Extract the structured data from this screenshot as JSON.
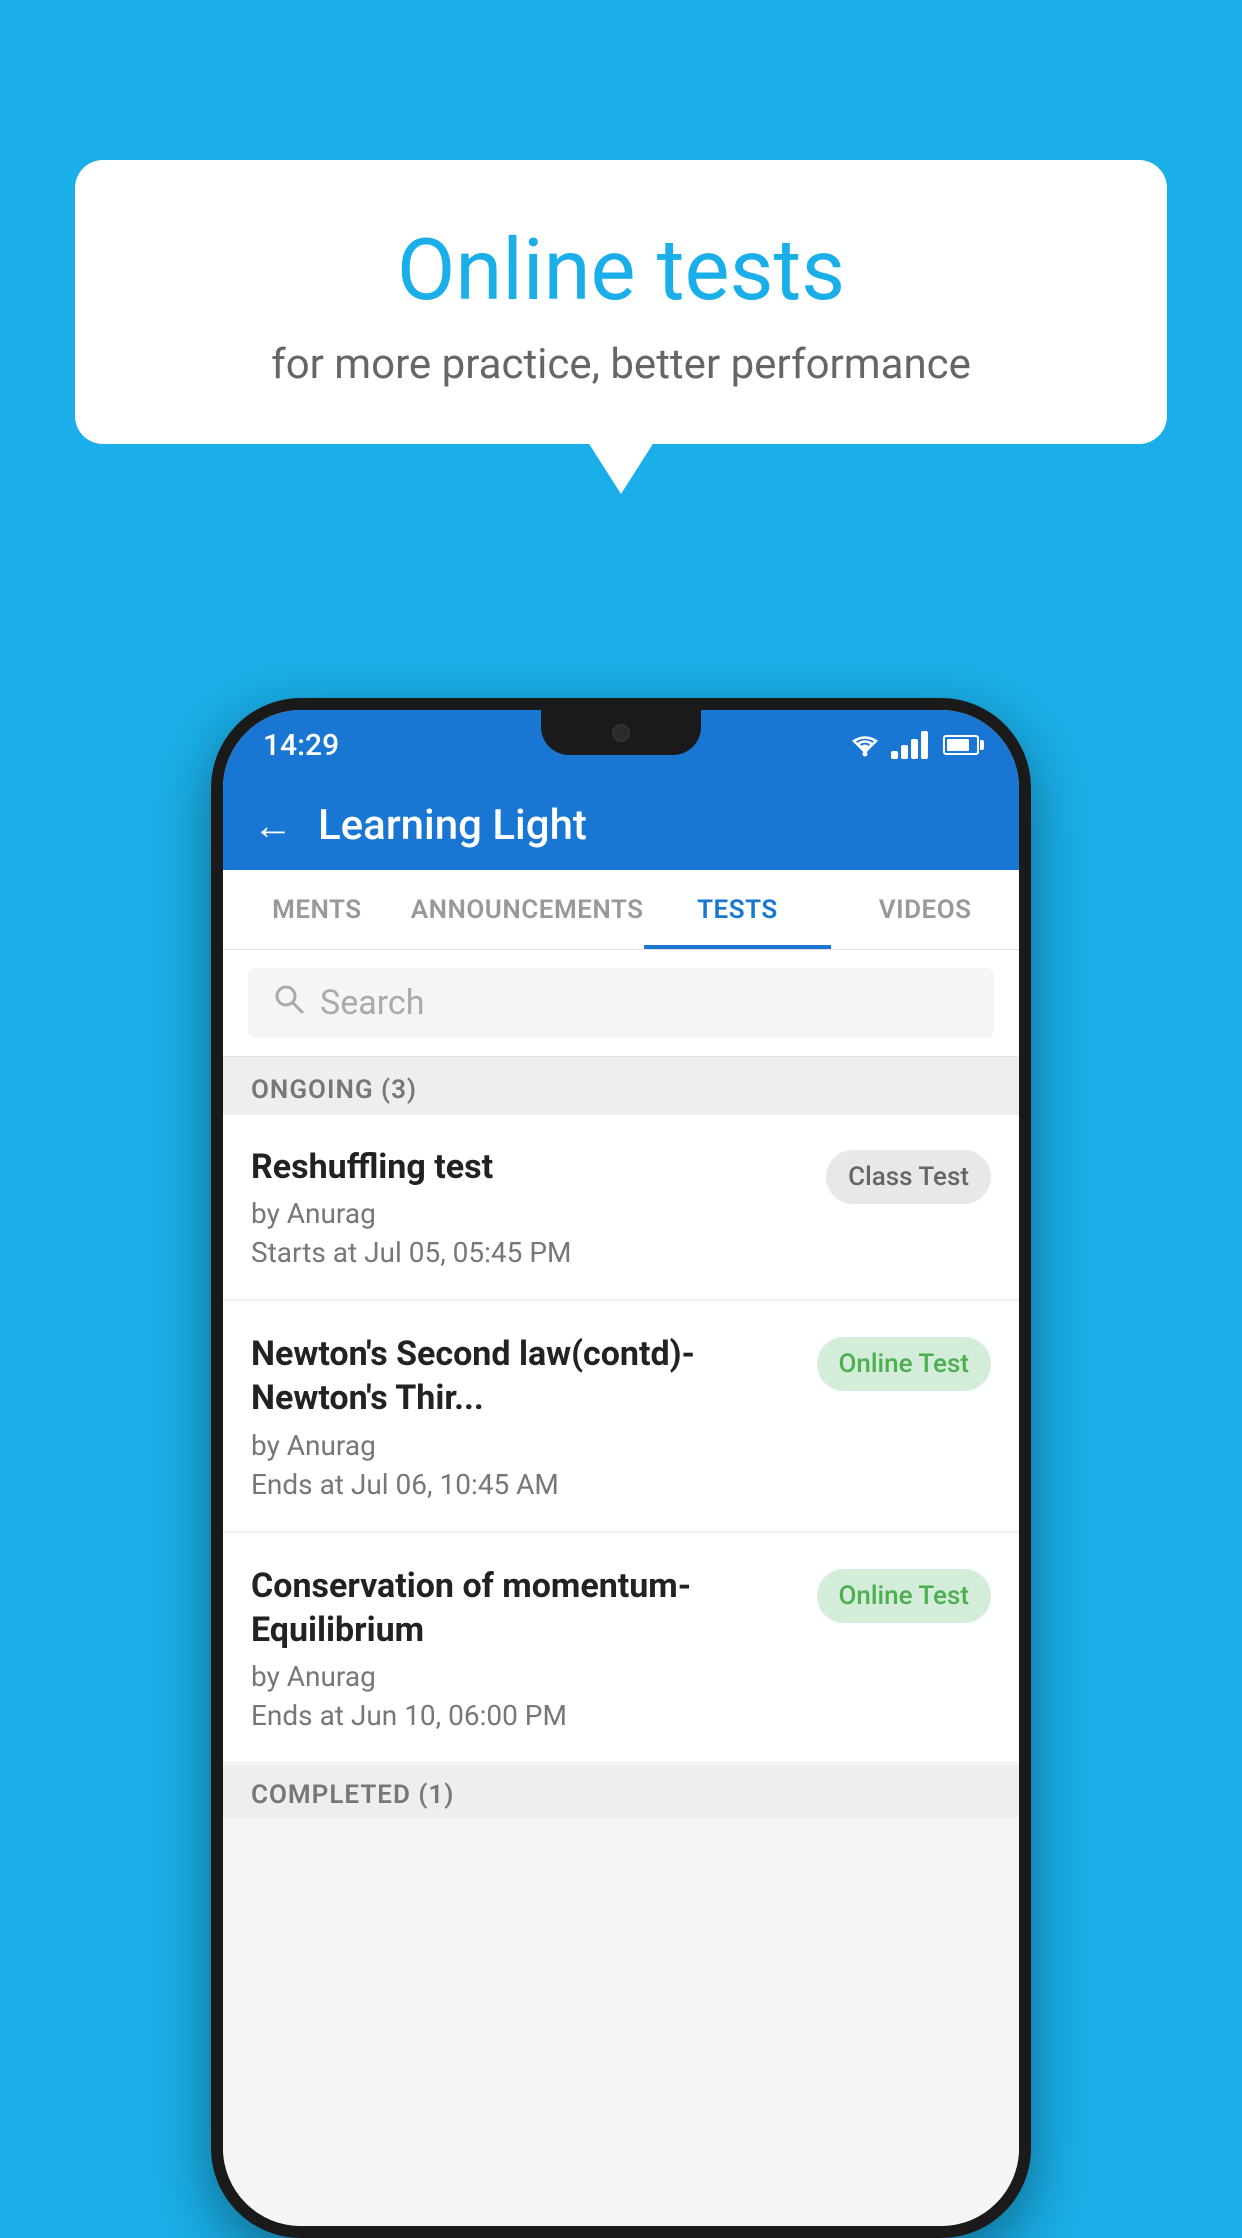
{
  "background": {
    "color": "#1AAFE8"
  },
  "bubble": {
    "title": "Online tests",
    "subtitle": "for more practice, better performance"
  },
  "status_bar": {
    "time": "14:29",
    "wifi": "▼",
    "signal": "signal",
    "battery": "battery"
  },
  "app_header": {
    "back_label": "←",
    "title": "Learning Light"
  },
  "tabs": [
    {
      "label": "MENTS",
      "active": false
    },
    {
      "label": "ANNOUNCEMENTS",
      "active": false
    },
    {
      "label": "TESTS",
      "active": true
    },
    {
      "label": "VIDEOS",
      "active": false
    }
  ],
  "search": {
    "placeholder": "Search"
  },
  "sections": [
    {
      "header": "ONGOING (3)",
      "items": [
        {
          "name": "Reshuffling test",
          "author": "by Anurag",
          "date": "Starts at  Jul 05, 05:45 PM",
          "badge": "Class Test",
          "badge_type": "class"
        },
        {
          "name": "Newton's Second law(contd)-Newton's Thir...",
          "author": "by Anurag",
          "date": "Ends at  Jul 06, 10:45 AM",
          "badge": "Online Test",
          "badge_type": "online"
        },
        {
          "name": "Conservation of momentum-Equilibrium",
          "author": "by Anurag",
          "date": "Ends at  Jun 10, 06:00 PM",
          "badge": "Online Test",
          "badge_type": "online"
        }
      ]
    }
  ],
  "completed_label": "COMPLETED (1)"
}
